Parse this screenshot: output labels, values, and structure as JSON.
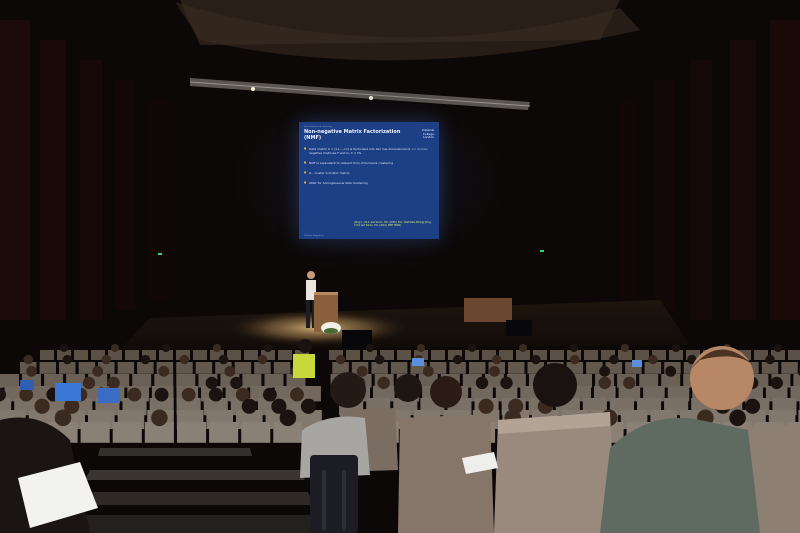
{
  "scene": {
    "description_free": true,
    "colors": {
      "background": "#0a0706",
      "screen": "#1d3f86",
      "spotlight": "#cfa76a",
      "seat": "#9a8a7d",
      "laptop": "#3b78d6"
    }
  },
  "slide": {
    "top_line": "Factorization and clustering",
    "title": "Non-negative Matrix Factorization (NMF)",
    "logo": "Imperial College London",
    "bullets": [
      "Data matrix X ≈ [x1,...,xn] is factorized into two low-dimensional (k << n) non-negative matrices F and G: X ≈ FG",
      "NMF is equivalent to relaxed form of K-means clustering",
      "G - cluster indicator matrix",
      "ONLY for homogeneous data clustering"
    ],
    "references": "[Ding C., He X. and Simon, H.D. (2005), Proc. SIAM Data Mining] [Ding, C.H.Q and Simon, H.D. (2010), IEEE TPAMI]",
    "footer": "Vladimir Gligorijevic"
  }
}
